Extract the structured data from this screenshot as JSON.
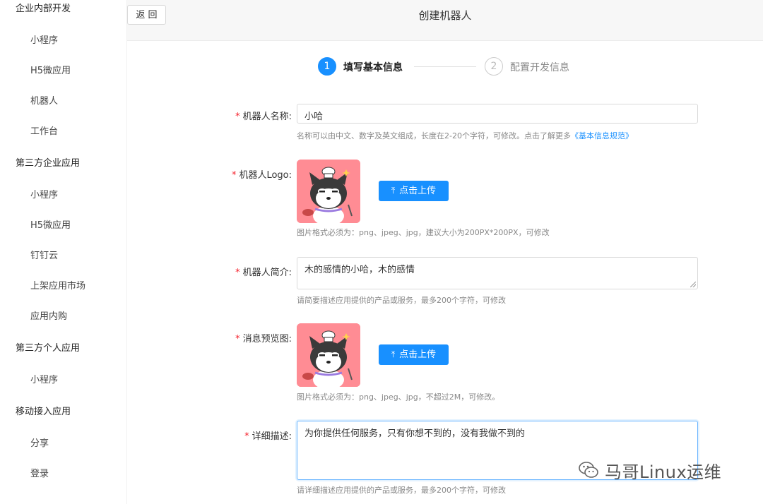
{
  "sidebar": {
    "groups": [
      {
        "label": "企业内部开发",
        "items": [
          "小程序",
          "H5微应用",
          "机器人",
          "工作台"
        ]
      },
      {
        "label": "第三方企业应用",
        "items": [
          "小程序",
          "H5微应用",
          "钉钉云",
          "上架应用市场",
          "应用内购"
        ]
      },
      {
        "label": "第三方个人应用",
        "items": [
          "小程序"
        ]
      },
      {
        "label": "移动接入应用",
        "items": [
          "分享",
          "登录"
        ]
      }
    ]
  },
  "header": {
    "back_label": "返 回",
    "title": "创建机器人"
  },
  "steps": [
    {
      "number": "1",
      "label": "填写基本信息",
      "active": true
    },
    {
      "number": "2",
      "label": "配置开发信息",
      "active": false
    }
  ],
  "form": {
    "required_mark": "*",
    "name": {
      "label": "机器人名称:",
      "value": "小哈",
      "help": "名称可以由中文、数字及英文组成，长度在2-20个字符，可修改。点击了解更多",
      "help_link": "《基本信息规范》"
    },
    "logo": {
      "label": "机器人Logo:",
      "upload_label": "点击上传",
      "help": "图片格式必须为：png、jpeg、jpg，建议大小为200PX*200PX，可修改"
    },
    "intro": {
      "label": "机器人简介:",
      "value": "木的感情的小哈，木的感情",
      "help": "请简要描述应用提供的产品或服务，最多200个字符，可修改"
    },
    "preview": {
      "label": "消息预览图:",
      "upload_label": "点击上传",
      "help": "图片格式必须为：png、jpeg、jpg，不超过2M，可修改。"
    },
    "detail": {
      "label": "详细描述:",
      "value": "为你提供任何服务，只有你想不到的，没有我做不到的",
      "help": "请详细描述应用提供的产品或服务，最多200个字符，可修改"
    }
  },
  "watermark": {
    "text": "马哥Linux运维"
  },
  "colors": {
    "primary": "#1890ff",
    "required": "#f5222d",
    "logo_bg": "#ff8c94"
  }
}
